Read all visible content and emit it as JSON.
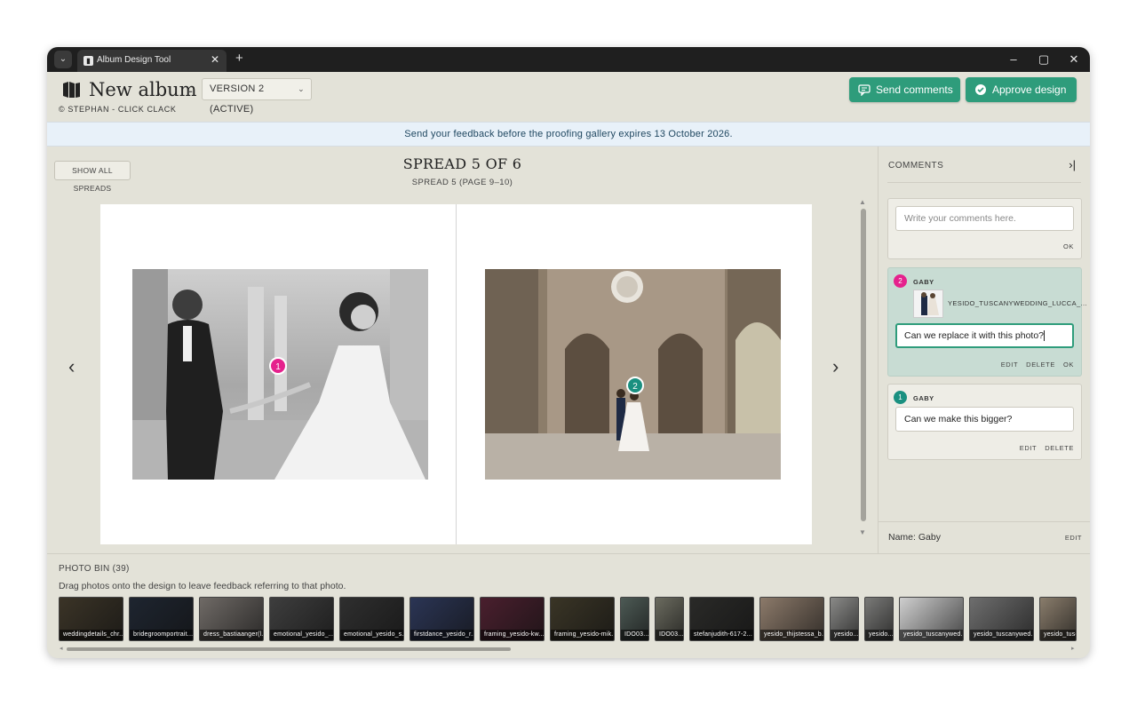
{
  "browser": {
    "tab_title": "Album Design Tool",
    "tab_close": "✕",
    "new_tab": "+",
    "menu": "⌄",
    "minimize": "–",
    "maximize": "▢",
    "close": "✕"
  },
  "header": {
    "album_title": "New album",
    "dash": "-",
    "version_label": "VERSION 2 (ACTIVE)",
    "copyright": "© STEPHAN - CLICK CLACK",
    "send_comments_label": "Send comments",
    "approve_label": "Approve design",
    "accent_color": "#2e9c7b"
  },
  "banner": {
    "text": "Send your feedback before the proofing gallery expires 13 October 2026."
  },
  "canvas": {
    "show_all_label": "SHOW ALL SPREADS",
    "spread_title": "SPREAD 5 OF 6",
    "spread_subtitle": "SPREAD 5 (PAGE 9–10)",
    "prev_arrow": "‹",
    "next_arrow": "›",
    "scroll_up": "▲",
    "scroll_down": "▼",
    "markers": [
      {
        "number": "2",
        "color": "#e5228d"
      },
      {
        "number": "1",
        "color": "#1a9080"
      }
    ]
  },
  "comments": {
    "title": "COMMENTS",
    "collapse_icon": "›|",
    "new_comment_placeholder": "Write your comments here.",
    "new_comment_ok": "OK",
    "items": [
      {
        "number": "2",
        "badge_color": "#e5228d",
        "author": "GABY",
        "attachment_name": "YESIDO_TUSCANYWEDDING_LUCCA_...",
        "text": "Can we replace it with this photo?",
        "actions": [
          "EDIT",
          "DELETE",
          "OK"
        ]
      },
      {
        "number": "1",
        "badge_color": "#1a9080",
        "author": "GABY",
        "text": "Can we make this bigger?",
        "actions": [
          "EDIT",
          "DELETE"
        ]
      }
    ],
    "footer_name": "Name: Gaby",
    "footer_edit": "EDIT"
  },
  "photo_bin": {
    "title": "PHOTO BIN (39)",
    "help": "Drag photos onto the design to leave feedback referring to that photo.",
    "scroll_left": "◂",
    "scroll_right": "▸",
    "photos": [
      "weddingdetails_chr...",
      "bridegroomportrait...",
      "dress_bastiaanger(l...",
      "emotional_yesido_...",
      "emotional_yesido_s...",
      "firstdance_yesido_r...",
      "framing_yesido-kw...",
      "framing_yesido-mik...",
      "IDO03...",
      "IDO03...",
      "stefanjudith-617-2...",
      "yesido_thijstessa_b...",
      "yesido...",
      "yesido...",
      "yesido_tuscanywed...",
      "yesido_tuscanywed...",
      "yesido_tusca..."
    ]
  }
}
